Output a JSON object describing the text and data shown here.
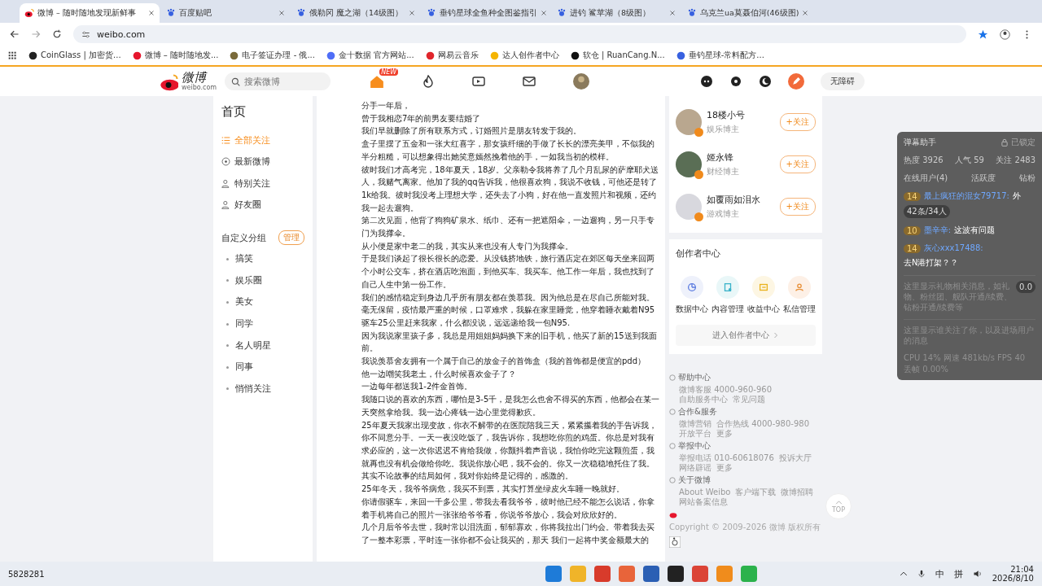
{
  "browser": {
    "tabs": [
      {
        "title": "微博 – 随时随地发现新鲜事",
        "selected": true
      },
      {
        "title": "百度贴吧",
        "selected": false
      },
      {
        "title": "俄勒冈 魔之湖（14级图）",
        "selected": false
      },
      {
        "title": "垂钓星球全鱼种全图鉴指引",
        "selected": false
      },
      {
        "title": "进钓 鲨苹湖（8级图）",
        "selected": false
      },
      {
        "title": "乌克兰ua莫聂伯河(46级图)",
        "selected": false
      }
    ],
    "address": "weibo.com",
    "bookmarks": [
      "CoinGlass | 加密货...",
      "微博 – 随时随地发...",
      "电子签证办理 - 俄...",
      "金十数据 官方网站...",
      "网易云音乐",
      "达人创作者中心",
      "软仓 | RuanCang.N...",
      "垂钓星球-常料配方..."
    ]
  },
  "header": {
    "logo": "微博",
    "logo_sub": "weibo.com",
    "search": {
      "placeholder": "搜索微博"
    },
    "new_badge": "NEW",
    "accessibility": "无障碍"
  },
  "nav": {
    "title": "首页",
    "items": [
      {
        "label": "全部关注",
        "selected": true
      },
      {
        "label": "最新微博",
        "selected": false
      },
      {
        "label": "特别关注",
        "selected": false
      },
      {
        "label": "好友圈",
        "selected": false
      }
    ],
    "groups_title": "自定义分组",
    "manage": "管理",
    "groups": [
      "搞笑",
      "娱乐圈",
      "美女",
      "同学",
      "名人明星",
      "同事",
      "悄悄关注"
    ]
  },
  "post": {
    "paragraphs": [
      "分手一年后，",
      "曾于我相恋7年的前男友要结婚了",
      "我们早就删除了所有联系方式，订婚照片是朋友转发于我的。",
      "盒子里摆了五金和一张大红喜字，那女孩纤细的手做了长长的漂亮美甲，不似我的半分粗糙，可以想象得出她笑意嫣然挽着他的手，一如我当初的模样。",
      "彼时我们才高考完，18年夏天，18岁。父亲勒令我将养了几个月乱尿的萨摩耶犬送人，我赌气离家。他加了我的qq告诉我，他很喜欢狗，我说不收钱，可他还是转了1k给我。彼时我没考上理想大学，还失去了小狗，好在他一直发照片和视频，还约我一起去遛狗。",
      "第二次见面，他背了狗狗矿泉水、纸巾、还有一把遮阳伞，一边遛狗，另一只手专门为我撑伞。",
      "从小便是家中老二的我，其实从来也没有人专门为我撑伞。",
      "于是我们谈起了很长很长的恋爱。从没钱挤地铁，旅行酒店定在郊区每天坐来回两个小时公交车，挤在酒店吃泡面，到他买车、我买车。他工作一年后，我也找到了自己人生中第一份工作。",
      "我们的感情稳定到身边几乎所有朋友都在羡慕我。因为他总是在尽自己所能对我。毫无保留，疫情最严重的时候，口罩难求，我躲在家里睡觉，他穿着睡衣戴着N95驱车25公里赶来我家，什么都没说，远远递给我一包N95.",
      "因为我说家里孩子多，我总是用姐姐妈妈换下来的旧手机，他买了新的15送到我面前。",
      "我说羡慕舍友拥有一个属于自己的放金子的首饰盒（我的首饰都是便宜的pdd）",
      "他一边嘲笑我老土，什么时候喜欢金子了？",
      "一边每年都送我1-2件金首饰。",
      "我随口说的喜欢的东西，哪怕是3-5千，是我怎么也舍不得买的东西，他都会在某一天突然拿给我。我一边心疼钱一边心里觉得歉疚。",
      "25年夏天我家出现变故，你衣不解带的在医院陪我三天，紧紧攥着我的手告诉我，你不同意分手。一天一夜没吃饭了，我告诉你，我想吃你煎的鸡蛋。你总是对我有求必应的，这一次你迟迟不肯给我做，你颤抖着声音说，我怕你吃完这颗煎蛋，我就再也没有机会做给你吃。我说你放心吧，我不会的。你又一次稳稳地托住了我。其实不论故事的结局如何，我对你始终是记得的，感激的。",
      "25年冬天，我爷爷病危，我买不到票，其实打算坐绿皮火车睡一晚就好。",
      "你请假驱车，来回一千多公里，带我去看我爷爷，彼时他已经不能怎么说话，你拿着手机将自己的照片一张张给爷爷看，你说爷爷放心，我会对欣欣好的。",
      "几个月后爷爷去世，我时常以泪洗面，郁郁寡欢，你将我拉出门约会。带着我去买了一整本彩票，平时连一张你都不会让我买的，那天 我们一起将中奖金额最大的"
    ]
  },
  "suggestions": [
    {
      "name": "18楼小号",
      "tag": "娱乐博主",
      "follow": "+关注"
    },
    {
      "name": "姬永锋",
      "tag": "财经博主",
      "follow": "+关注"
    },
    {
      "name": "如覆雨如泪水",
      "tag": "游戏博主",
      "follow": "+关注"
    }
  ],
  "creator": {
    "title": "创作者中心",
    "tools": [
      {
        "label": "数据中心",
        "kind": "data"
      },
      {
        "label": "内容管理",
        "kind": "content"
      },
      {
        "label": "收益中心",
        "kind": "income"
      },
      {
        "label": "私信管理",
        "kind": "message"
      }
    ],
    "enter": "进入创作者中心"
  },
  "footer": {
    "sections": [
      {
        "title": "帮助中心",
        "links": [
          "微博客服 4000-960-960",
          "自助服务中心",
          "常见问题"
        ]
      },
      {
        "title": "合作&服务",
        "links": [
          "微博营销",
          "合作热线 4000-980-980",
          "开放平台",
          "更多"
        ]
      },
      {
        "title": "举报中心",
        "links": [
          "举报电话 010-60618076",
          "投诉大厅",
          "网络辟谣",
          "更多"
        ]
      },
      {
        "title": "关于微博",
        "links": [
          "About Weibo",
          "客户端下载",
          "微博招聘",
          "网站备案信息"
        ]
      }
    ],
    "copyright": "Copyright © 2009-2026 微博 版权所有"
  },
  "top_button": "TOP",
  "danmu": {
    "title": "弹幕助手",
    "lock": "已锁定",
    "stats": [
      "热度 3926",
      "人气 59",
      "关注 2483"
    ],
    "tabs": [
      "在线用户(4)",
      "活跃度",
      "钻粉"
    ],
    "messages": [
      {
        "level": "14",
        "user": "最上疯狂的混女79717:",
        "text": "外"
      },
      {
        "level": "10",
        "user": "墨辛辛:",
        "text": "这波有问题"
      },
      {
        "level": "14",
        "user": "灰心xxx17488:",
        "text": "去N港打架？？"
      }
    ],
    "count_pill": "42条/34人",
    "gift_note": "这里显示礼物相关消息，如礼物、粉丝团、舰队开通/续费、钻粉开通/续费等",
    "gift_pill": "0.0",
    "follow_note": "这里显示谁关注了你，以及进场用户的消息",
    "perf": "CPU 14% 网速 481kb/s FPS 40 丢帧 0.00%"
  },
  "taskbar": {
    "left_text": "5828281",
    "ime": "中",
    "ime2": "拼",
    "time": "21:04",
    "date": "2026/8/10"
  }
}
